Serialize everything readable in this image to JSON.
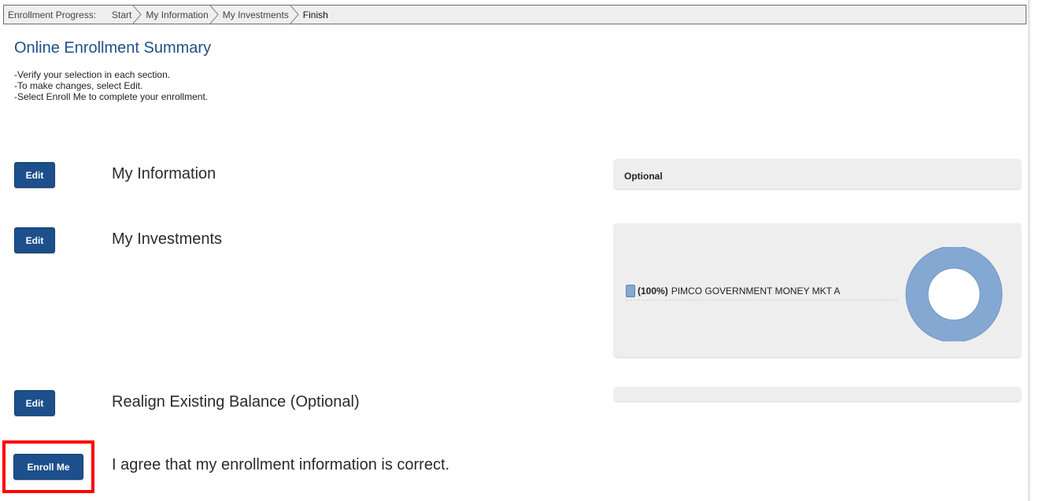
{
  "progress": {
    "label": "Enrollment Progress:",
    "steps": [
      "Start",
      "My Information",
      "My Investments",
      "Finish"
    ]
  },
  "page": {
    "title": "Online Enrollment Summary",
    "instructions": [
      "-Verify your selection in each section.",
      "-To make changes, select Edit.",
      "-Select Enroll Me to complete your enrollment."
    ]
  },
  "sections": [
    {
      "edit_label": "Edit",
      "title": "My Information",
      "panel_text": "Optional"
    },
    {
      "edit_label": "Edit",
      "title": "My Investments",
      "allocation": {
        "percent": "(100%)",
        "fund": "PIMCO GOVERNMENT MONEY MKT A",
        "value": 100
      }
    },
    {
      "edit_label": "Edit",
      "title": "Realign Existing Balance (Optional)"
    }
  ],
  "enroll": {
    "button_label": "Enroll Me",
    "agree_text": "I agree that my enrollment information is correct."
  },
  "colors": {
    "primary_button": "#1c4f8c",
    "title": "#1f5088",
    "donut_fill": "#85a8d3",
    "highlight": "#ff0000"
  }
}
